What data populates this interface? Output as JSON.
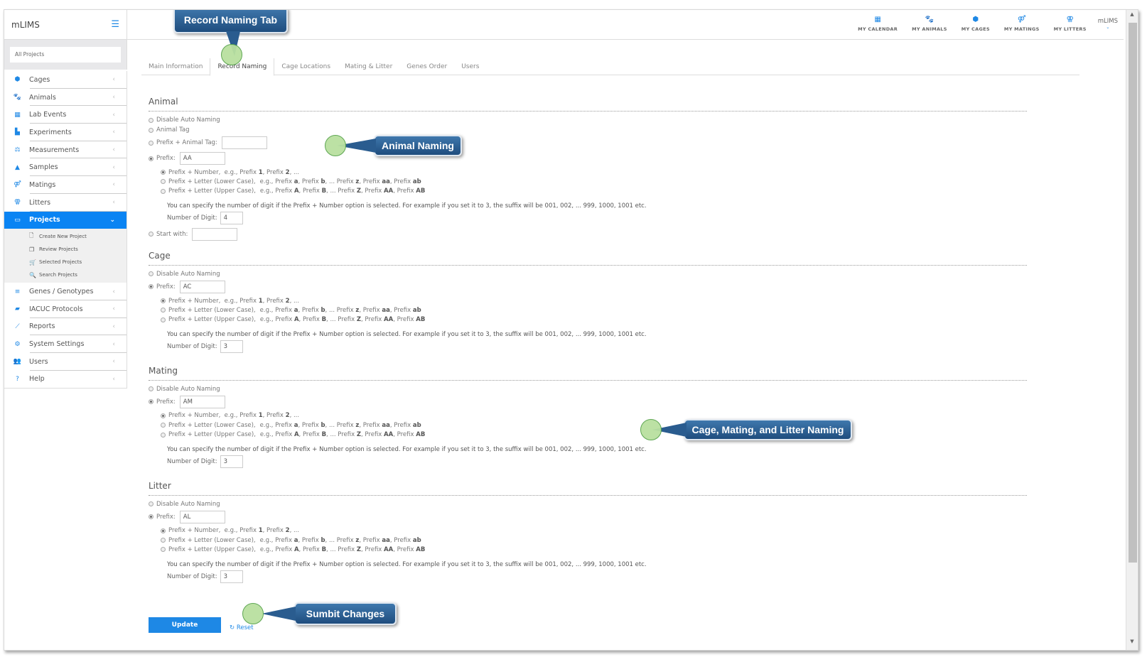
{
  "app": {
    "brand": "mLIMS"
  },
  "sidebar": {
    "project_filter": "All Projects",
    "items": [
      {
        "label": "Cages",
        "icon": "cube-icon",
        "glyph": "⬢"
      },
      {
        "label": "Animals",
        "icon": "paw-icon",
        "glyph": "🐾"
      },
      {
        "label": "Lab Events",
        "icon": "calendar-icon",
        "glyph": "▦"
      },
      {
        "label": "Experiments",
        "icon": "files-icon",
        "glyph": "▙"
      },
      {
        "label": "Measurements",
        "icon": "balance-icon",
        "glyph": "⚖"
      },
      {
        "label": "Samples",
        "icon": "flask-icon",
        "glyph": "▲"
      },
      {
        "label": "Matings",
        "icon": "mating-icon",
        "glyph": "⚤"
      },
      {
        "label": "Litters",
        "icon": "litter-icon",
        "glyph": "⚢"
      },
      {
        "label": "Projects",
        "icon": "folder-open-icon",
        "glyph": "▭",
        "active": true
      },
      {
        "label": "Genes / Genotypes",
        "icon": "list-icon",
        "glyph": "≡"
      },
      {
        "label": "IACUC Protocols",
        "icon": "book-icon",
        "glyph": "▰"
      },
      {
        "label": "Reports",
        "icon": "chart-line-icon",
        "glyph": "⟋"
      },
      {
        "label": "System Settings",
        "icon": "gear-icon",
        "glyph": "⚙"
      },
      {
        "label": "Users",
        "icon": "users-icon",
        "glyph": "👥"
      },
      {
        "label": "Help",
        "icon": "question-icon",
        "glyph": "?"
      }
    ],
    "projects_sub": [
      {
        "label": "Create New Project",
        "icon": "file-icon",
        "glyph": "🗋"
      },
      {
        "label": "Review Projects",
        "icon": "copy-icon",
        "glyph": "❐"
      },
      {
        "label": "Selected Projects",
        "icon": "cart-icon",
        "glyph": "🛒"
      },
      {
        "label": "Search Projects",
        "icon": "search-icon",
        "glyph": "🔍"
      }
    ]
  },
  "topbar": {
    "links": [
      {
        "label": "MY CALENDAR",
        "icon": "calendar-icon",
        "glyph": "▦"
      },
      {
        "label": "MY ANIMALS",
        "icon": "paw-icon",
        "glyph": "🐾"
      },
      {
        "label": "MY CAGES",
        "icon": "cube-icon",
        "glyph": "⬢"
      },
      {
        "label": "MY MATINGS",
        "icon": "mating-icon",
        "glyph": "⚤"
      },
      {
        "label": "MY LITTERS",
        "icon": "litter-icon",
        "glyph": "⚢"
      }
    ],
    "user": "mLIMS",
    "user_caret": "⌄"
  },
  "tabs": [
    {
      "label": "Main Information"
    },
    {
      "label": "Record Naming",
      "active": true
    },
    {
      "label": "Cage Locations"
    },
    {
      "label": "Mating & Litter"
    },
    {
      "label": "Genes Order"
    },
    {
      "label": "Users"
    }
  ],
  "common": {
    "disable_auto": "Disable Auto Naming",
    "prefix_label": "Prefix:",
    "opt_number": [
      "Prefix + Number,",
      "  e.g., Prefix ",
      "1",
      ", Prefix ",
      "2",
      ", ..."
    ],
    "opt_lower": "Prefix + Letter (Lower Case),",
    "opt_upper": "Prefix + Letter (Upper Case),",
    "lower_example": [
      "e.g., Prefix ",
      "a",
      ", Prefix ",
      "b",
      ", ... Prefix ",
      "z",
      ", Prefix ",
      "aa",
      ", Prefix ",
      "ab"
    ],
    "upper_example": [
      "e.g., Prefix ",
      "A",
      ", Prefix ",
      "B",
      ", ... Prefix ",
      "Z",
      ", Prefix ",
      "AA",
      ", Prefix ",
      "AB"
    ],
    "hint": "You can specify the number of digit if the Prefix + Number option is selected. For example if you set it to 3, the suffix will be 001, 002, ... 999, 1000, 1001 etc.",
    "digits_label": "Number of Digit:"
  },
  "animal": {
    "title": "Animal",
    "animal_tag": "Animal Tag",
    "prefix_animal_tag": "Prefix + Animal Tag:",
    "prefix_animal_tag_value": "",
    "prefix_value": "AA",
    "digits": "4",
    "start_with": "Start with:",
    "start_with_value": ""
  },
  "cage": {
    "title": "Cage",
    "prefix_value": "AC",
    "digits": "3"
  },
  "mating": {
    "title": "Mating",
    "prefix_value": "AM",
    "digits": "3"
  },
  "litter": {
    "title": "Litter",
    "prefix_value": "AL",
    "digits": "3"
  },
  "actions": {
    "update": "Update",
    "reset": "Reset",
    "reset_glyph": "↻"
  },
  "callouts": {
    "record_naming_tab": "Record Naming Tab",
    "animal_naming": "Animal Naming",
    "cage_mating_litter": "Cage, Mating, and Litter Naming",
    "submit": "Sumbit Changes"
  }
}
